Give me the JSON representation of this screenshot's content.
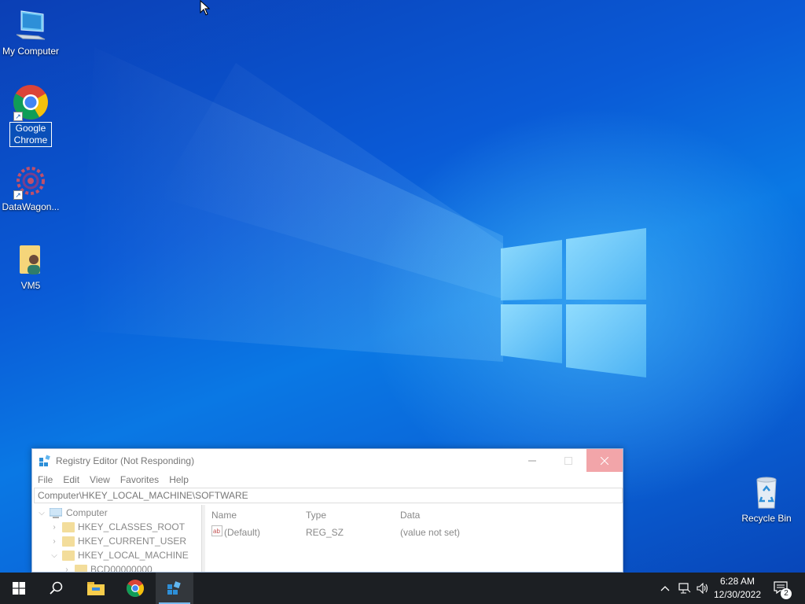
{
  "desktop": {
    "icons": [
      {
        "label": "My Computer",
        "icon": "computer-icon"
      },
      {
        "label": "Google Chrome",
        "icon": "chrome-icon",
        "selected": true
      },
      {
        "label": "DataWagon...",
        "icon": "datawagon-icon"
      },
      {
        "label": "VM5",
        "icon": "user-folder-icon"
      },
      {
        "label": "Recycle Bin",
        "icon": "recycle-bin-icon"
      }
    ]
  },
  "registry_window": {
    "title": "Registry Editor (Not Responding)",
    "menu": [
      "File",
      "Edit",
      "View",
      "Favorites",
      "Help"
    ],
    "address": "Computer\\HKEY_LOCAL_MACHINE\\SOFTWARE",
    "tree": [
      "Computer",
      "HKEY_CLASSES_ROOT",
      "HKEY_CURRENT_USER",
      "HKEY_LOCAL_MACHINE",
      "BCD00000000"
    ],
    "columns": [
      "Name",
      "Type",
      "Data"
    ],
    "rows": [
      {
        "name": "(Default)",
        "type": "REG_SZ",
        "data": "(value not set)"
      }
    ]
  },
  "taskbar": {
    "pinned": [
      "windows-start-icon",
      "search-icon",
      "file-explorer-icon",
      "chrome-icon",
      "registry-editor-icon"
    ],
    "active": "registry-editor-icon",
    "clock": {
      "time": "6:28 AM",
      "date": "12/30/2022"
    },
    "notification_count": "2"
  },
  "colors": {
    "taskbar_bg": "#1c1f23",
    "close_button_hover": "#f2a5a9",
    "selection_blue": "#0a50b8"
  }
}
